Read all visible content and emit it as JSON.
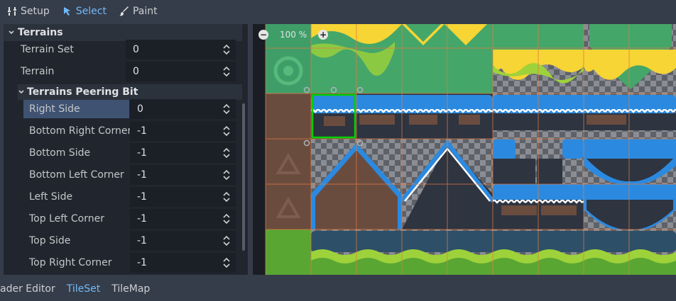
{
  "toolbar": {
    "setup_label": "Setup",
    "select_label": "Select",
    "paint_label": "Paint"
  },
  "inspector": {
    "section_title": "Terrains",
    "terrain_set": {
      "label": "Terrain Set",
      "value": "0"
    },
    "terrain": {
      "label": "Terrain",
      "value": "0"
    },
    "peering_title": "Terrains Peering Bit",
    "peering_bits": [
      {
        "label": "Right Side",
        "value": "0"
      },
      {
        "label": "Bottom Right Corner",
        "value": "-1"
      },
      {
        "label": "Bottom Side",
        "value": "-1"
      },
      {
        "label": "Bottom Left Corner",
        "value": "-1"
      },
      {
        "label": "Left Side",
        "value": "-1"
      },
      {
        "label": "Top Left Corner",
        "value": "-1"
      },
      {
        "label": "Top Side",
        "value": "-1"
      },
      {
        "label": "Top Right Corner",
        "value": "-1"
      }
    ]
  },
  "viewport": {
    "zoom_label": "100 %",
    "zoom_out_icon": "zoom-out-icon",
    "zoom_in_icon": "zoom-in-icon"
  },
  "bottom_tabs": {
    "shader_editor": "ader Editor",
    "tileset": "TileSet",
    "tilemap": "TileMap"
  },
  "colors": {
    "accent": "#70bafa",
    "selection_row": "#3f5272",
    "tile_selection": "#00d000",
    "grid": "#e07a3f",
    "grass": "#45a66a",
    "sand": "#f6d534",
    "water": "#2b8ae0",
    "dirt": "#6a4c3f"
  }
}
